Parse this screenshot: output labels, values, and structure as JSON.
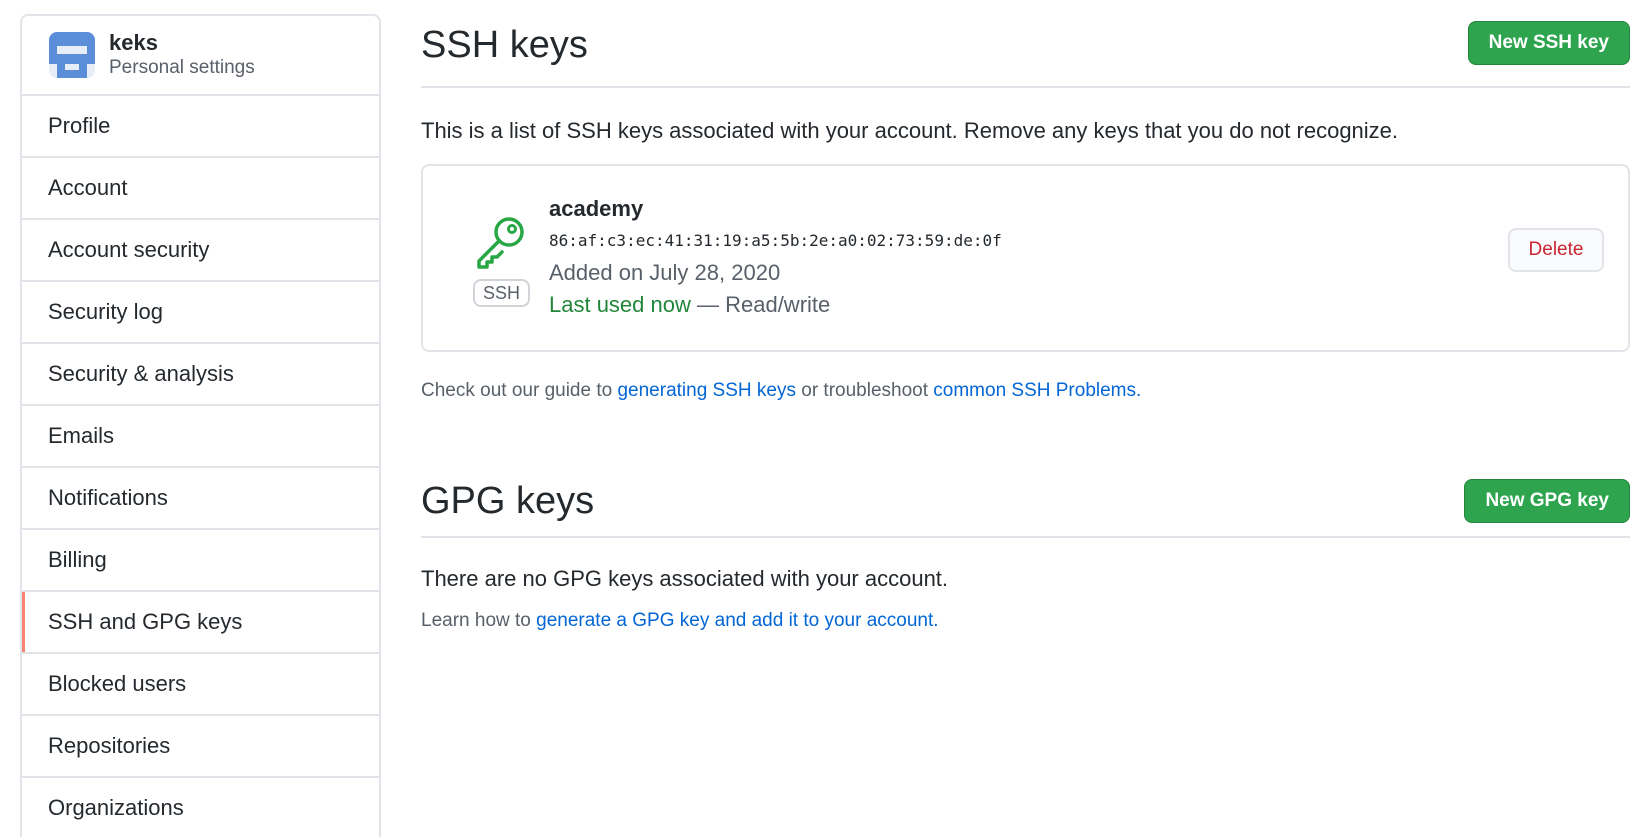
{
  "sidebar": {
    "user": {
      "name": "keks",
      "subtitle": "Personal settings"
    },
    "items": [
      {
        "label": "Profile",
        "selected": false
      },
      {
        "label": "Account",
        "selected": false
      },
      {
        "label": "Account security",
        "selected": false
      },
      {
        "label": "Security log",
        "selected": false
      },
      {
        "label": "Security & analysis",
        "selected": false
      },
      {
        "label": "Emails",
        "selected": false
      },
      {
        "label": "Notifications",
        "selected": false
      },
      {
        "label": "Billing",
        "selected": false
      },
      {
        "label": "SSH and GPG keys",
        "selected": true
      },
      {
        "label": "Blocked users",
        "selected": false
      },
      {
        "label": "Repositories",
        "selected": false
      },
      {
        "label": "Organizations",
        "selected": false
      }
    ]
  },
  "ssh": {
    "title": "SSH keys",
    "new_button": "New SSH key",
    "intro": "This is a list of SSH keys associated with your account. Remove any keys that you do not recognize.",
    "key": {
      "icon": "key-icon",
      "badge": "SSH",
      "title": "academy",
      "fingerprint": "86:af:c3:ec:41:31:19:a5:5b:2e:a0:02:73:59:de:0f",
      "added": "Added on July 28, 2020",
      "last_used": "Last used now",
      "access": " — Read/write",
      "delete_label": "Delete"
    },
    "guide": {
      "prefix": "Check out our guide to ",
      "link1": "generating SSH keys",
      "middle": " or troubleshoot ",
      "link2": "common SSH Problems",
      "suffix": "."
    }
  },
  "gpg": {
    "title": "GPG keys",
    "new_button": "New GPG key",
    "empty": "There are no GPG keys associated with your account.",
    "learn": {
      "prefix": "Learn how to ",
      "link": "generate a GPG key and add it to your account",
      "suffix": "."
    }
  },
  "colors": {
    "green_button": "#2ea44f",
    "link": "#0366d6",
    "danger": "#cb2431",
    "selected_marker": "#f9826c",
    "key_icon": "#28a745"
  }
}
